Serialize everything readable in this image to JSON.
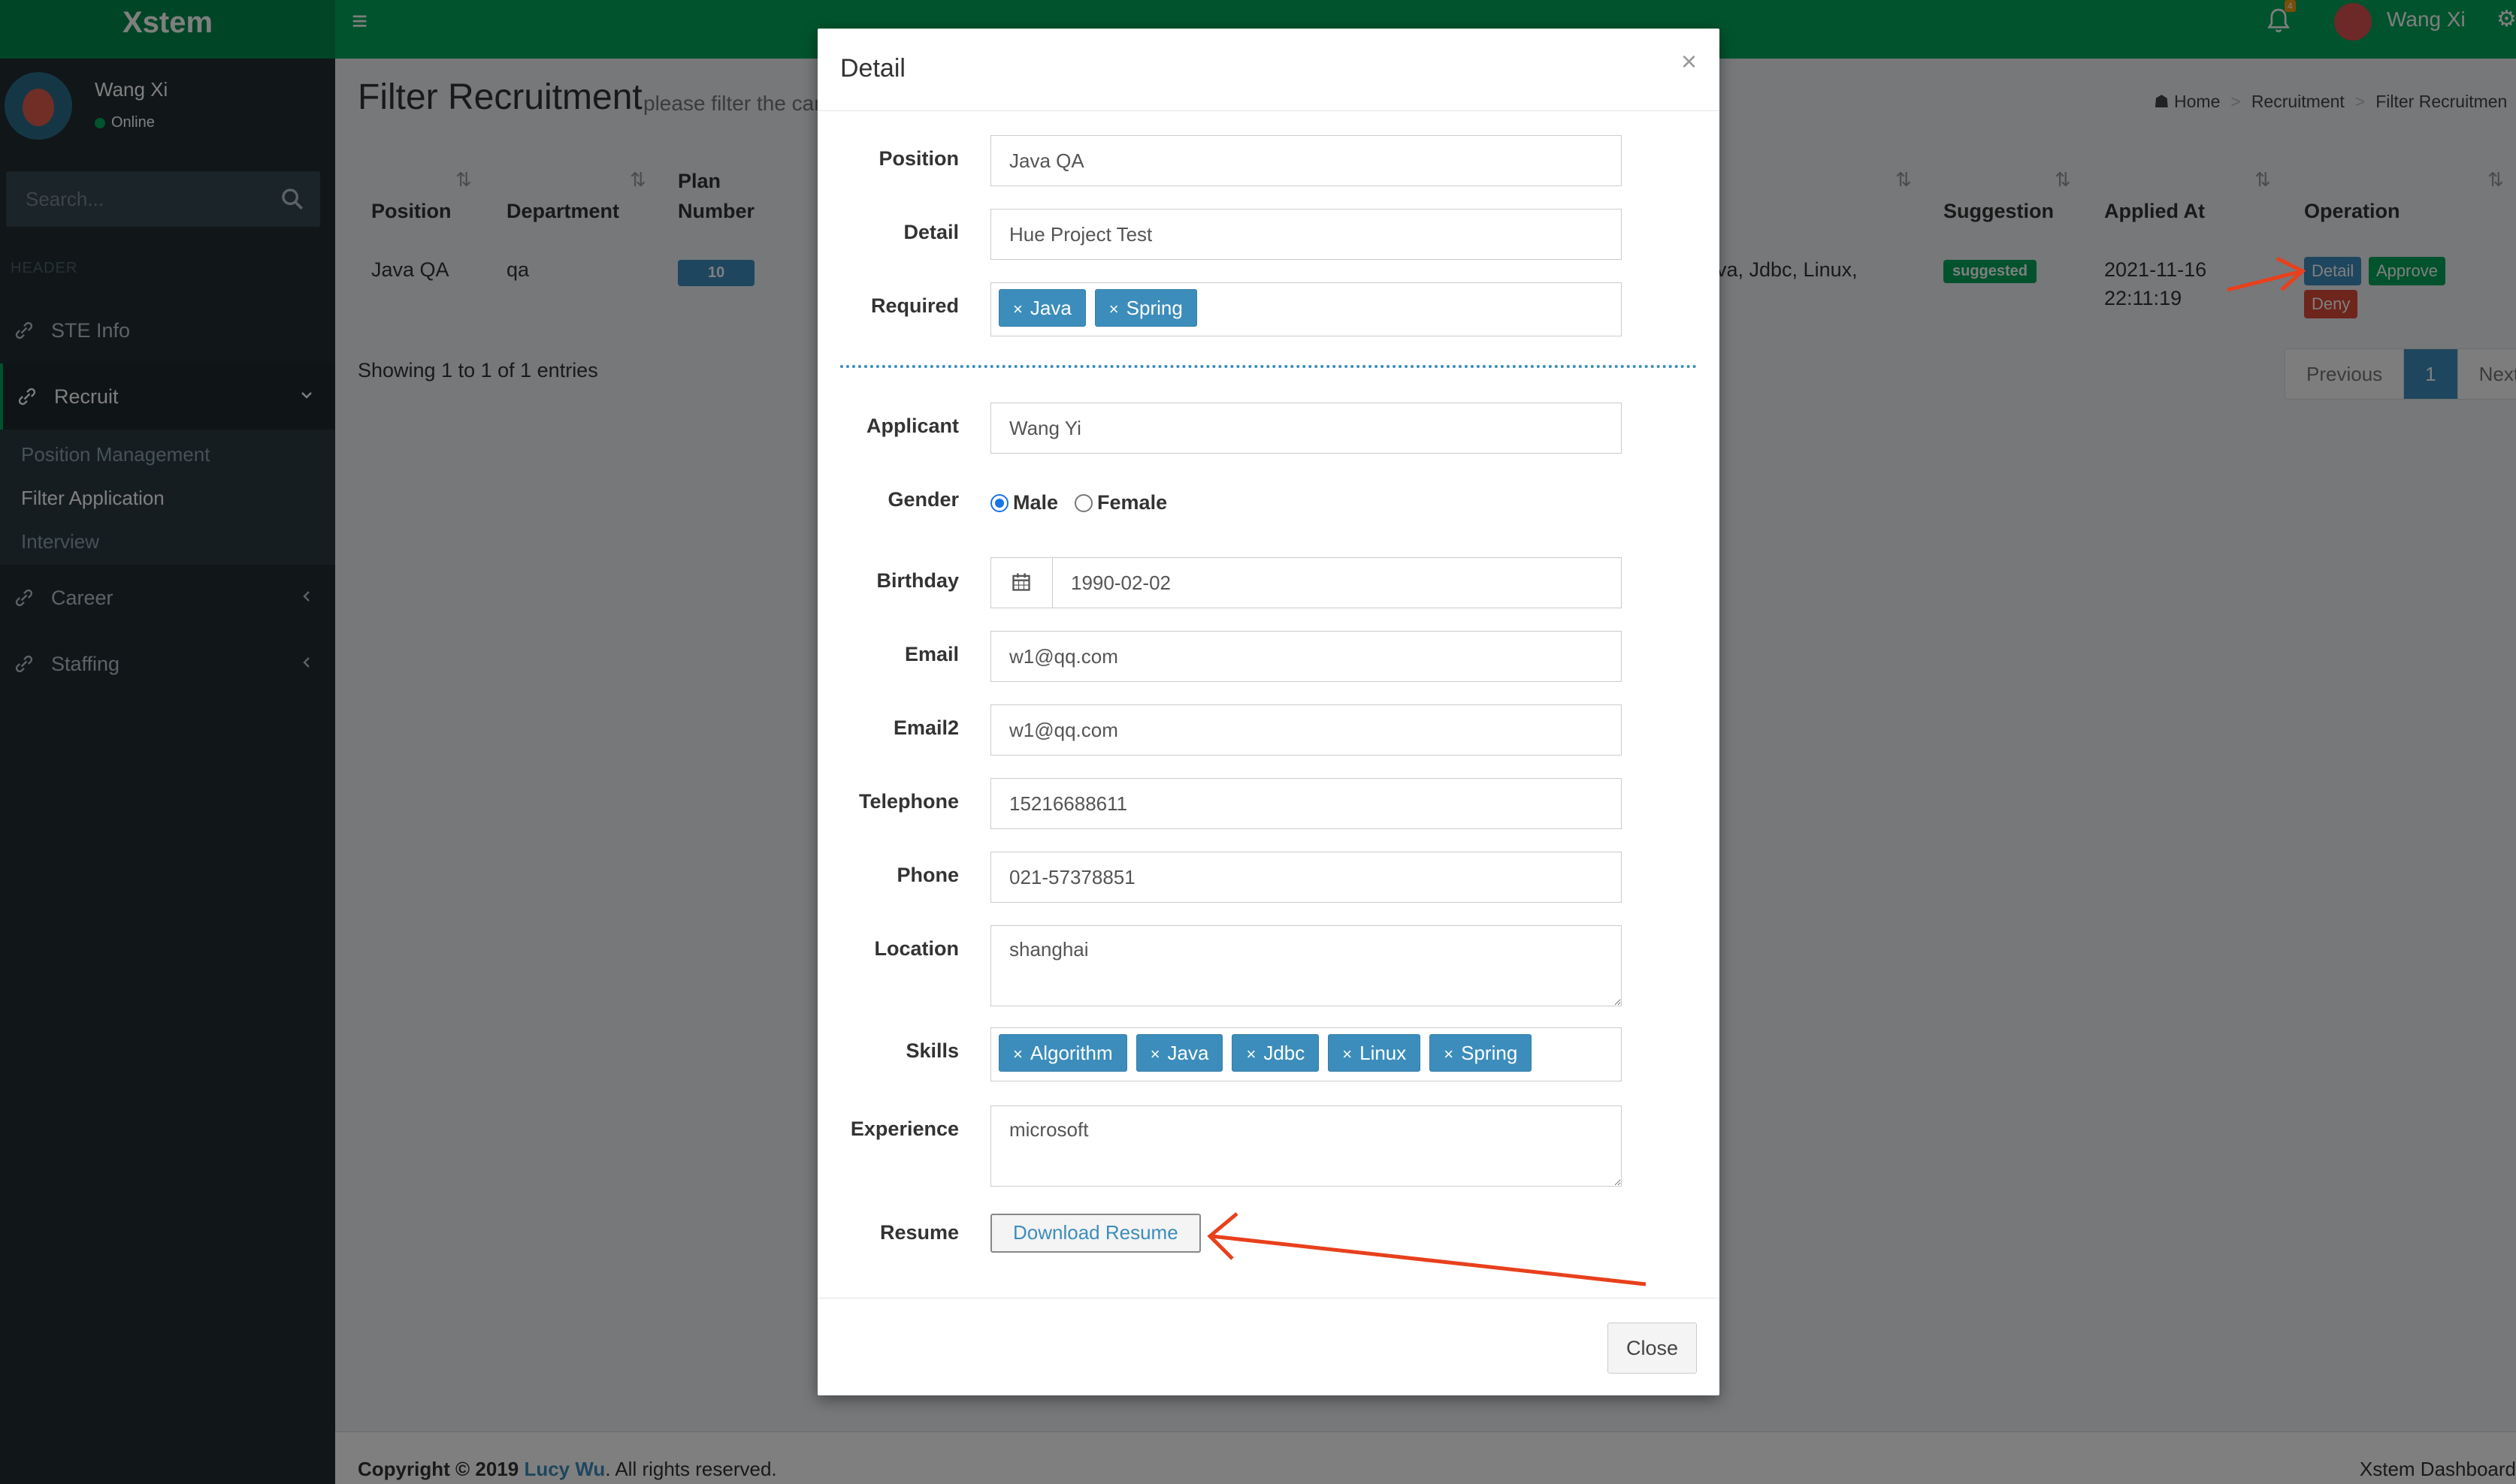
{
  "app": {
    "brand": "Xstem"
  },
  "topbar": {
    "user_name": "Wang Xi",
    "notification_count": "4"
  },
  "sidebar": {
    "user_name": "Wang Xi",
    "status": "Online",
    "search_placeholder": "Search...",
    "header_label": "HEADER",
    "items": [
      {
        "label": "STE Info"
      },
      {
        "label": "Recruit"
      },
      {
        "label": "Career"
      },
      {
        "label": "Staffing"
      }
    ],
    "submenu": [
      {
        "label": "Position Management"
      },
      {
        "label": "Filter Application"
      },
      {
        "label": "Interview"
      }
    ]
  },
  "page": {
    "title": "Filter Recruitment",
    "subtitle": "please filter the can",
    "breadcrumb": [
      "Home",
      "Recruitment",
      "Filter Recruitmen"
    ]
  },
  "table": {
    "headers": {
      "position": "Position",
      "department": "Department",
      "plan_line1": "Plan",
      "plan_line2": "Number",
      "suggestion": "Suggestion",
      "applied_at": "Applied At",
      "operation": "Operation"
    },
    "row": {
      "position": "Java QA",
      "department": "qa",
      "plan_number": "10",
      "skills_partial": "va, Jdbc, Linux,",
      "suggestion": "suggested",
      "applied_date": "2021-11-16",
      "applied_time": "22:11:19",
      "btn_detail": "Detail",
      "btn_approve": "Approve",
      "btn_deny": "Deny"
    },
    "showing": "Showing 1 to 1 of 1 entries",
    "pagination": {
      "previous": "Previous",
      "page": "1",
      "next": "Next"
    }
  },
  "modal": {
    "title": "Detail",
    "close_x": "×",
    "labels": {
      "position": "Position",
      "detail": "Detail",
      "required": "Required",
      "applicant": "Applicant",
      "gender": "Gender",
      "birthday": "Birthday",
      "email": "Email",
      "email2": "Email2",
      "telephone": "Telephone",
      "phone": "Phone",
      "location": "Location",
      "skills": "Skills",
      "experience": "Experience",
      "resume": "Resume"
    },
    "values": {
      "position": "Java QA",
      "detail": "Hue Project Test",
      "applicant": "Wang Yi",
      "birthday": "1990-02-02",
      "email": "w1@qq.com",
      "email2": "w1@qq.com",
      "telephone": "15216688611",
      "phone": "021-57378851",
      "location": "shanghai",
      "experience": "microsoft"
    },
    "required_tags": [
      "Java",
      "Spring"
    ],
    "skill_tags": [
      "Algorithm",
      "Java",
      "Jdbc",
      "Linux",
      "Spring"
    ],
    "gender_options": {
      "male": "Male",
      "female": "Female",
      "selected": "Male"
    },
    "download_label": "Download Resume",
    "close_label": "Close"
  },
  "footer": {
    "copyright_prefix": "Copyright © 2019",
    "author": "Lucy Wu",
    "rights": ". All rights reserved.",
    "right_text": "Xstem Dashboard"
  },
  "colors": {
    "header_green": "#00a65a",
    "sidebar_dark": "#222d32",
    "primary_blue": "#3c8dbc",
    "annotation_red": "#e8401c"
  }
}
